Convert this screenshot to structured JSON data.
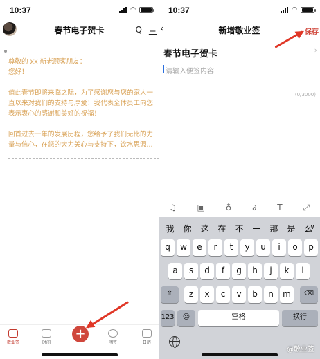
{
  "status": {
    "time_left": "10:37",
    "time_right": "10:37"
  },
  "left": {
    "header": {
      "title": "春节电子贺卡",
      "search_glyph": "Q",
      "menu_glyph": "三"
    },
    "note_lines": [
      "尊敬的 xx 新老顾客朋友：",
      "您好！",
      "值此春节即将来临之际，为了感谢您与您的家人一",
      "直以来对我们的支持与厚爱！我代表全体员工向您",
      "表示衷心的感谢和美好的祝福！",
      "回首过去一年的发展历程，您给予了我们无比的力",
      "量与信心，在您的大力关心与支持下，饮水思源..."
    ],
    "tabs": [
      {
        "label": "敬业签",
        "active": true
      },
      {
        "label": "时间",
        "active": false
      },
      {
        "label": "团签",
        "active": false
      },
      {
        "label": "日历",
        "active": false
      }
    ],
    "add_label": "+"
  },
  "right": {
    "header": {
      "title": "新增敬业签",
      "back_glyph": "‹",
      "save_label": "保存"
    },
    "note_title": "春节电子贺卡",
    "input_placeholder": "请输入便签内容",
    "char_counter": "(0/3000)",
    "toolbar_icons": [
      "bell-icon",
      "image-icon",
      "microphone-icon",
      "paperclip-icon",
      "text-format-icon",
      "expand-icon"
    ],
    "candidates": [
      "我",
      "你",
      "这",
      "在",
      "不",
      "一",
      "那",
      "是",
      "么"
    ],
    "keyboard": {
      "row1": [
        "q",
        "w",
        "e",
        "r",
        "t",
        "y",
        "u",
        "i",
        "o",
        "p"
      ],
      "row2": [
        "a",
        "s",
        "d",
        "f",
        "g",
        "h",
        "j",
        "k",
        "l"
      ],
      "row3": [
        "z",
        "x",
        "c",
        "v",
        "b",
        "n",
        "m"
      ],
      "numbers_label": "123",
      "space_label": "空格",
      "return_label": "换行"
    },
    "watermark": "@敬业签"
  },
  "colors": {
    "accent": "#d0473c",
    "note_text": "#d9a256",
    "arrow": "#e03626"
  }
}
